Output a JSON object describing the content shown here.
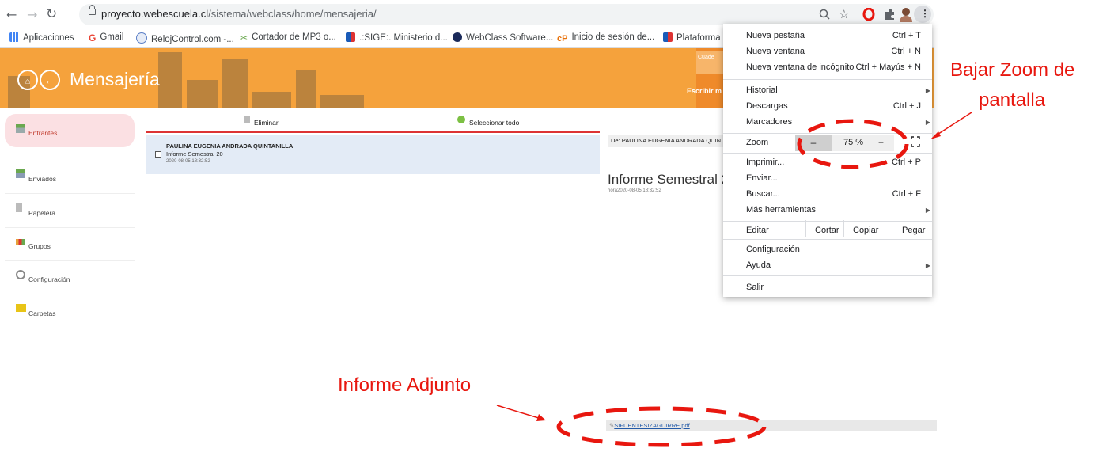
{
  "browser": {
    "url_host": "proyecto.webescuela.cl",
    "url_path": "/sistema/webclass/home/mensajeria/",
    "bookmarks": [
      {
        "label": "Aplicaciones",
        "color": "#4285f4"
      },
      {
        "label": "Gmail",
        "color": "#ea4335"
      },
      {
        "label": "RelojControl.com -...",
        "color": "#5b7fc7"
      },
      {
        "label": "Cortador de MP3 o...",
        "color": "#6aa84f"
      },
      {
        "label": ".:SIGE:. Ministerio d...",
        "color": "#d33"
      },
      {
        "label": "WebClass Software...",
        "color": "#1a2a5a"
      },
      {
        "label": "Inicio de sesión de...",
        "color": "#e8710a"
      },
      {
        "label": "Plataforma E",
        "color": "#d33"
      }
    ]
  },
  "header": {
    "title": "Mensajería",
    "right_text": "Escribir m",
    "cuaderno_text": "Cuade"
  },
  "sidebar": {
    "items": [
      {
        "label": "Entrantes"
      },
      {
        "label": "Enviados"
      },
      {
        "label": "Papelera"
      },
      {
        "label": "Grupos"
      },
      {
        "label": "Configuración"
      },
      {
        "label": "Carpetas"
      }
    ]
  },
  "list": {
    "delete_label": "Eliminar",
    "select_all_label": "Seleccionar todo",
    "messages": [
      {
        "sender": "PAULINA EUGENIA ANDRADA QUINTANILLA",
        "subject": "Informe Semestral 20",
        "date": "2020-08-05 18:32:52"
      }
    ]
  },
  "message": {
    "from_label": "De: PAULINA EUGENIA ANDRADA QUIN",
    "subject": "Informe Semestral 2",
    "date": "hora2020-08-05 18:32:52",
    "attachment": "SIFUENTESIZAGUIRRE.pdf"
  },
  "menu": {
    "new_tab": "Nueva pestaña",
    "new_tab_sc": "Ctrl + T",
    "new_window": "Nueva ventana",
    "new_window_sc": "Ctrl + N",
    "incognito": "Nueva ventana de incógnito",
    "incognito_sc": "Ctrl + Mayús + N",
    "history": "Historial",
    "downloads": "Descargas",
    "downloads_sc": "Ctrl + J",
    "bookmarks": "Marcadores",
    "zoom": "Zoom",
    "zoom_minus": "–",
    "zoom_value": "75 %",
    "zoom_plus": "+",
    "print": "Imprimir...",
    "print_sc": "Ctrl + P",
    "cast": "Enviar...",
    "find": "Buscar...",
    "find_sc": "Ctrl + F",
    "more_tools": "Más herramientas",
    "edit": "Editar",
    "cut": "Cortar",
    "copy": "Copiar",
    "paste": "Pegar",
    "settings": "Configuración",
    "help": "Ayuda",
    "exit": "Salir"
  },
  "annotations": {
    "zoom_note_line1": "Bajar Zoom de",
    "zoom_note_line2": "pantalla",
    "attach_note": "Informe Adjunto",
    "color": "#e8170f"
  }
}
